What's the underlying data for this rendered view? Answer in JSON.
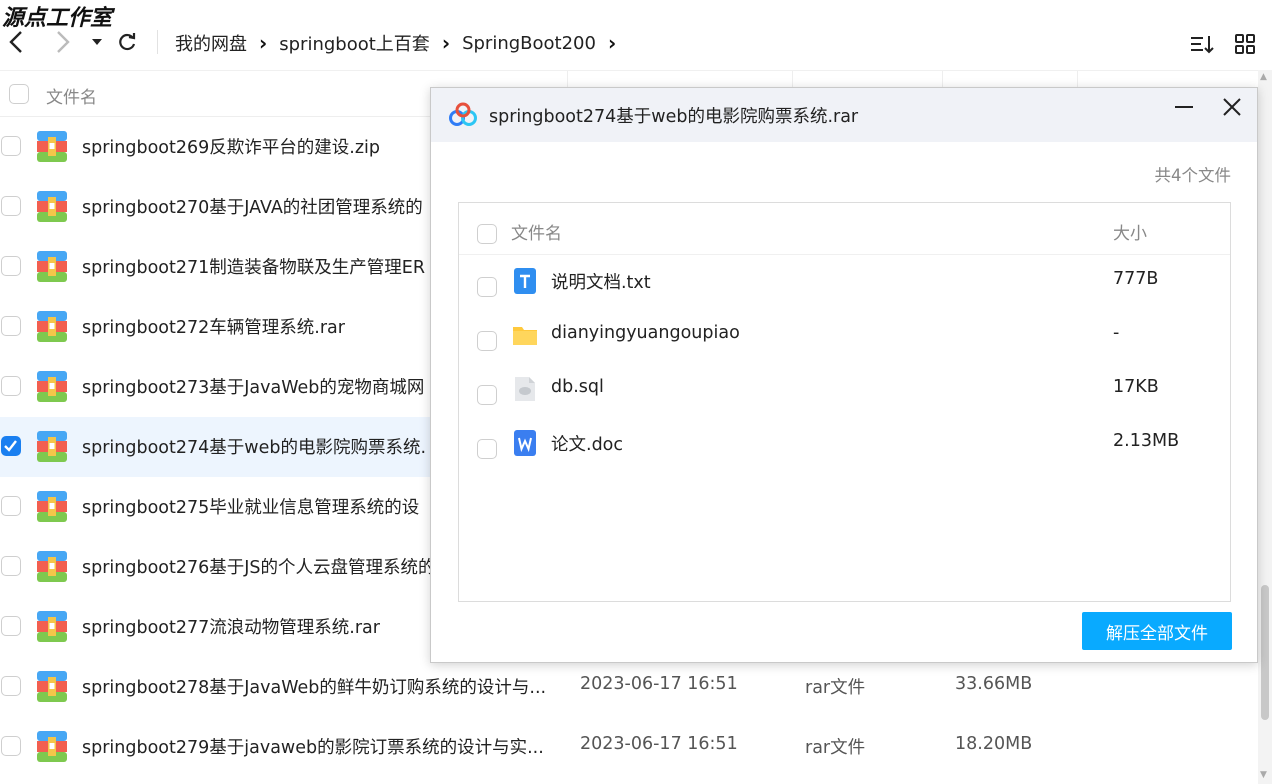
{
  "watermark": "源点工作室",
  "toolbar": {
    "breadcrumb": [
      "我的网盘",
      "springboot上百套",
      "SpringBoot200"
    ]
  },
  "table": {
    "header_name": "文件名",
    "rows": [
      {
        "name": "springboot269反欺诈平台的建设.zip",
        "date": "",
        "type": "",
        "size": "",
        "selected": false
      },
      {
        "name": "springboot270基于JAVA的社团管理系统的",
        "date": "",
        "type": "",
        "size": "",
        "selected": false
      },
      {
        "name": "springboot271制造装备物联及生产管理ER",
        "date": "",
        "type": "",
        "size": "",
        "selected": false
      },
      {
        "name": "springboot272车辆管理系统.rar",
        "date": "",
        "type": "",
        "size": "",
        "selected": false
      },
      {
        "name": "springboot273基于JavaWeb的宠物商城网",
        "date": "",
        "type": "",
        "size": "",
        "selected": false
      },
      {
        "name": "springboot274基于web的电影院购票系统.",
        "date": "",
        "type": "",
        "size": "",
        "selected": true
      },
      {
        "name": "springboot275毕业就业信息管理系统的设",
        "date": "",
        "type": "",
        "size": "",
        "selected": false
      },
      {
        "name": "springboot276基于JS的个人云盘管理系统的",
        "date": "",
        "type": "",
        "size": "",
        "selected": false
      },
      {
        "name": "springboot277流浪动物管理系统.rar",
        "date": "",
        "type": "",
        "size": "",
        "selected": false
      },
      {
        "name": "springboot278基于JavaWeb的鲜牛奶订购系统的设计与...",
        "date": "2023-06-17 16:51",
        "type": "rar文件",
        "size": "33.66MB",
        "selected": false
      },
      {
        "name": "springboot279基于javaweb的影院订票系统的设计与实...",
        "date": "2023-06-17 16:51",
        "type": "rar文件",
        "size": "18.20MB",
        "selected": false
      }
    ]
  },
  "dialog": {
    "title": "springboot274基于web的电影院购票系统.rar",
    "count": "共4个文件",
    "header_name": "文件名",
    "header_size": "大小",
    "files": [
      {
        "name": "说明文档.txt",
        "size": "777B",
        "icon": "txt-file-icon"
      },
      {
        "name": "dianyingyuangoupiao",
        "size": "-",
        "icon": "folder-icon"
      },
      {
        "name": "db.sql",
        "size": "17KB",
        "icon": "sql-file-icon"
      },
      {
        "name": "论文.doc",
        "size": "2.13MB",
        "icon": "word-file-icon"
      }
    ],
    "extract_label": "解压全部文件"
  },
  "colors": {
    "accent": "#09aaff",
    "checkbox_checked": "#1a7ff0",
    "selected_row": "#edf5fe"
  }
}
